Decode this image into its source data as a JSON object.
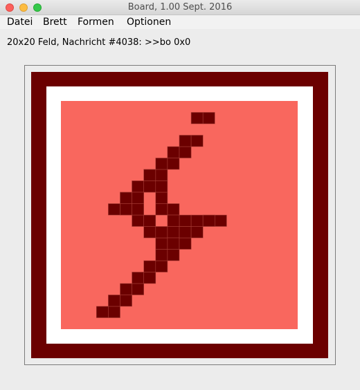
{
  "window": {
    "title": "Board, 1.00 Sept. 2016"
  },
  "menu": {
    "items": [
      "Datei",
      "Brett",
      "Formen",
      "Optionen"
    ]
  },
  "status": {
    "text": "20x20 Feld, Nachricht #4038: >>bo 0x0"
  },
  "board": {
    "colors": {
      "frame": "#6b0000",
      "border": "#ffffff",
      "field": "#f9675e",
      "cell": "#6b0000",
      "cell_line": "#a63c36"
    },
    "grid_cols": 20,
    "grid_rows": 20,
    "shape_parts": [
      {
        "type": "diagonal_band",
        "from": [
          3,
          8
        ],
        "to": [
          9,
          1
        ]
      },
      {
        "type": "diamond",
        "center": [
          7,
          10
        ]
      },
      {
        "type": "diagonal_band",
        "from": [
          3,
          18
        ],
        "to": [
          11,
          10
        ]
      }
    ]
  }
}
